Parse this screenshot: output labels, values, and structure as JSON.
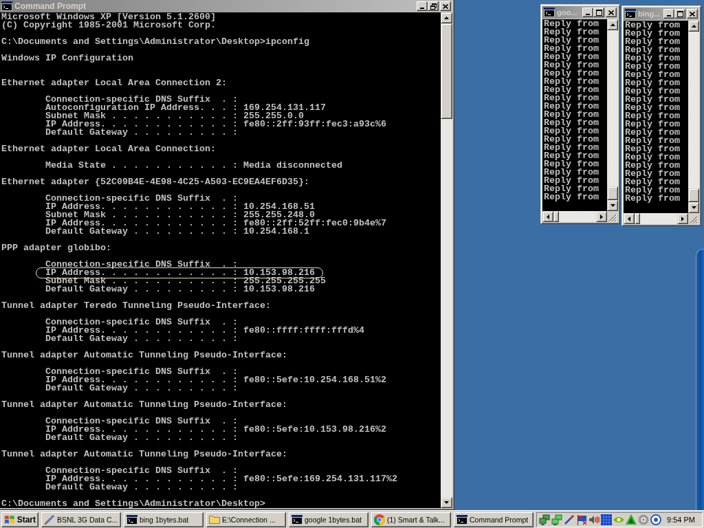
{
  "main_window": {
    "title": "Command Prompt",
    "console": {
      "banner": [
        "Microsoft Windows XP [Version 5.1.2600]",
        "(C) Copyright 1985-2001 Microsoft Corp."
      ],
      "command": "C:\\Documents and Settings\\Administrator\\Desktop>ipconfig",
      "heading": "Windows IP Configuration",
      "adapters": [
        {
          "name": "Ethernet adapter Local Area Connection 2:",
          "entries": [
            {
              "label": "Connection-specific DNS Suffix  . :",
              "circled": false
            },
            {
              "label": "Autoconfiguration IP Address. . . :",
              "value": "169.254.131.117",
              "circled": false
            },
            {
              "label": "Subnet Mask . . . . . . . . . . . :",
              "value": "255.255.0.0",
              "circled": false
            },
            {
              "label": "IP Address. . . . . . . . . . . . :",
              "value": "fe80::2ff:93ff:fec3:a93c%6",
              "circled": false
            },
            {
              "label": "Default Gateway . . . . . . . . . :",
              "circled": false
            }
          ]
        },
        {
          "name": "Ethernet adapter Local Area Connection:",
          "entries": [
            {
              "label": "Media State . . . . . . . . . . . :",
              "value": "Media disconnected",
              "circled": false
            }
          ]
        },
        {
          "name": "Ethernet adapter {52C09B4E-4E98-4C25-A503-EC9EA4EF6D35}:",
          "entries": [
            {
              "label": "Connection-specific DNS Suffix  . :",
              "circled": false
            },
            {
              "label": "IP Address. . . . . . . . . . . . :",
              "value": "10.254.168.51",
              "circled": false
            },
            {
              "label": "Subnet Mask . . . . . . . . . . . :",
              "value": "255.255.248.0",
              "circled": false
            },
            {
              "label": "IP Address. . . . . . . . . . . . :",
              "value": "fe80::2ff:52ff:fec0:9b4e%7",
              "circled": false
            },
            {
              "label": "Default Gateway . . . . . . . . . :",
              "value": "10.254.168.1",
              "circled": false
            }
          ]
        },
        {
          "name": "PPP adapter globibo:",
          "entries": [
            {
              "label": "Connection-specific DNS Suffix  . :",
              "circled": false
            },
            {
              "label": "IP Address. . . . . . . . . . . . :",
              "value": "10.153.98.216",
              "circled": true
            },
            {
              "label": "Subnet Mask . . . . . . . . . . . :",
              "value": "255.255.255.255",
              "circled": false
            },
            {
              "label": "Default Gateway . . . . . . . . . :",
              "value": "10.153.98.216",
              "circled": false
            }
          ]
        },
        {
          "name": "Tunnel adapter Teredo Tunneling Pseudo-Interface:",
          "entries": [
            {
              "label": "Connection-specific DNS Suffix  . :",
              "circled": false
            },
            {
              "label": "IP Address. . . . . . . . . . . . :",
              "value": "fe80::ffff:ffff:fffd%4",
              "circled": false
            },
            {
              "label": "Default Gateway . . . . . . . . . :",
              "circled": false
            }
          ]
        },
        {
          "name": "Tunnel adapter Automatic Tunneling Pseudo-Interface:",
          "entries": [
            {
              "label": "Connection-specific DNS Suffix  . :",
              "circled": false
            },
            {
              "label": "IP Address. . . . . . . . . . . . :",
              "value": "fe80::5efe:10.254.168.51%2",
              "circled": false
            },
            {
              "label": "Default Gateway . . . . . . . . . :",
              "circled": false
            }
          ]
        },
        {
          "name": "Tunnel adapter Automatic Tunneling Pseudo-Interface:",
          "entries": [
            {
              "label": "Connection-specific DNS Suffix  . :",
              "circled": false
            },
            {
              "label": "IP Address. . . . . . . . . . . . :",
              "value": "fe80::5efe:10.153.98.216%2",
              "circled": false
            },
            {
              "label": "Default Gateway . . . . . . . . . :",
              "circled": false
            }
          ]
        },
        {
          "name": "Tunnel adapter Automatic Tunneling Pseudo-Interface:",
          "entries": [
            {
              "label": "Connection-specific DNS Suffix  . :",
              "circled": false
            },
            {
              "label": "IP Address. . . . . . . . . . . . :",
              "value": "fe80::5efe:169.254.131.117%2",
              "circled": false
            },
            {
              "label": "Default Gateway . . . . . . . . . :",
              "circled": false
            }
          ]
        }
      ],
      "prompt": "C:\\Documents and Settings\\Administrator\\Desktop>"
    }
  },
  "side_windows": [
    {
      "title": "goo...",
      "lines": [
        "Reply from",
        "Reply from",
        "Reply from",
        "Reply from",
        "Reply from",
        "Reply from",
        "Reply from",
        "Reply from",
        "Reply from",
        "Reply from",
        "Reply from",
        "Reply from",
        "Reply from",
        "Reply from",
        "Reply from",
        "Reply from",
        "Reply from",
        "Reply from",
        "Reply from",
        "Reply from",
        "Reply from",
        "Reply from"
      ]
    },
    {
      "title": "bing...",
      "lines": [
        "Reply from",
        "Reply from",
        "Reply from",
        "Reply from",
        "Reply from",
        "Reply from",
        "Reply from",
        "Reply from",
        "Reply from",
        "Reply from",
        "Reply from",
        "Reply from",
        "Reply from",
        "Reply from",
        "Reply from",
        "Reply from",
        "Reply from",
        "Reply from",
        "Reply from",
        "Reply from",
        "Reply from",
        "Reply from"
      ]
    }
  ],
  "taskbar": {
    "start_button": "Start",
    "tasks": [
      {
        "label": "BSNL 3G Data C...",
        "kind": "app"
      },
      {
        "label": "bing 1bytes.bat",
        "kind": "console"
      },
      {
        "label": "E:\\Connection ...",
        "kind": "folder"
      },
      {
        "label": "google 1bytes.bat",
        "kind": "console"
      },
      {
        "label": "(1) Smart & Talk...",
        "kind": "web"
      },
      {
        "label": "Command Prompt",
        "kind": "console"
      }
    ],
    "clock": "9:54 PM"
  }
}
